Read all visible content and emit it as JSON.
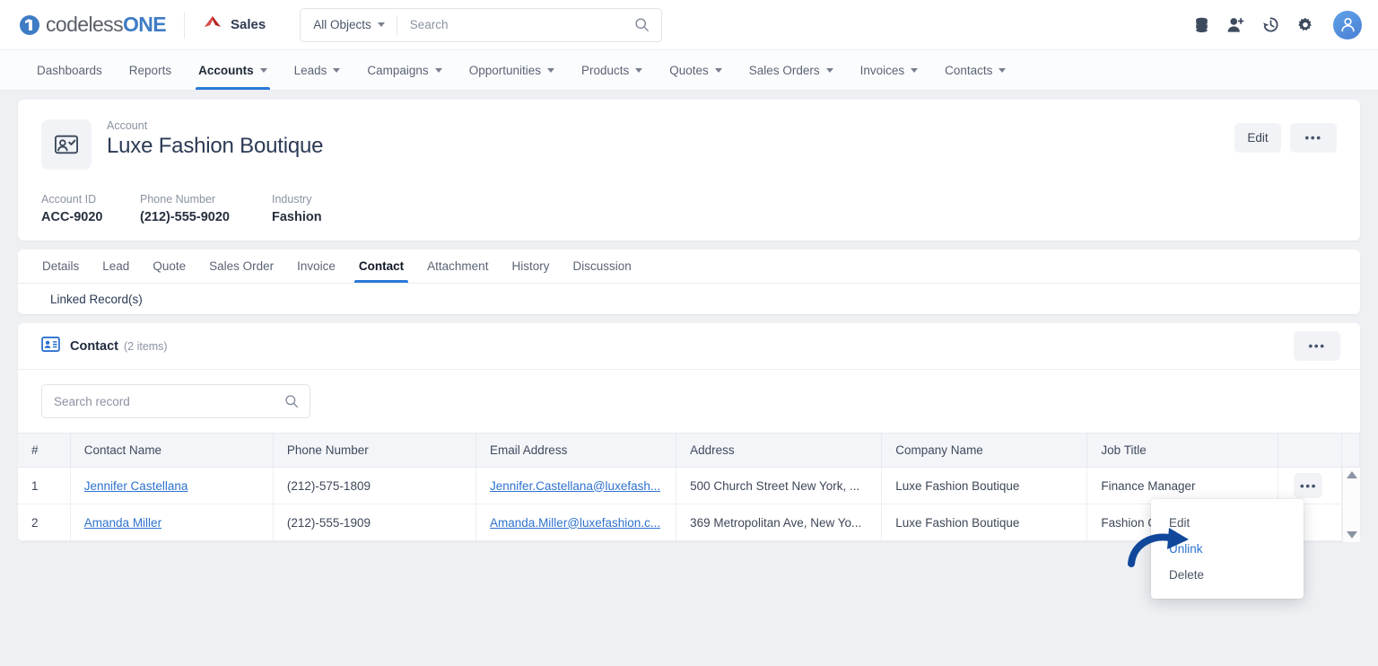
{
  "header": {
    "logo_text_1": "codeless",
    "logo_text_2": "ONE",
    "logo_mark_icon": "one-circle-icon",
    "app_icon": "sales-app-icon",
    "app_label": "Sales",
    "object_selector_label": "All Objects",
    "search_placeholder": "Search",
    "search_value": "",
    "search_icon": "search-icon",
    "icons": [
      {
        "name": "database-icon"
      },
      {
        "name": "add-user-icon"
      },
      {
        "name": "history-icon"
      },
      {
        "name": "gear-icon"
      }
    ],
    "avatar_icon": "user-avatar-icon"
  },
  "nav": {
    "items": [
      {
        "label": "Dashboards",
        "has_caret": false,
        "active": false
      },
      {
        "label": "Reports",
        "has_caret": false,
        "active": false
      },
      {
        "label": "Accounts",
        "has_caret": true,
        "active": true
      },
      {
        "label": "Leads",
        "has_caret": true,
        "active": false
      },
      {
        "label": "Campaigns",
        "has_caret": true,
        "active": false
      },
      {
        "label": "Opportunities",
        "has_caret": true,
        "active": false
      },
      {
        "label": "Products",
        "has_caret": true,
        "active": false
      },
      {
        "label": "Quotes",
        "has_caret": true,
        "active": false
      },
      {
        "label": "Sales Orders",
        "has_caret": true,
        "active": false
      },
      {
        "label": "Invoices",
        "has_caret": true,
        "active": false
      },
      {
        "label": "Contacts",
        "has_caret": true,
        "active": false
      }
    ]
  },
  "account": {
    "thumb_icon": "account-card-icon",
    "kicker": "Account",
    "title": "Luxe Fashion Boutique",
    "edit_label": "Edit",
    "more_label": "•••",
    "fields": [
      {
        "label": "Account ID",
        "value": "ACC-9020"
      },
      {
        "label": "Phone Number",
        "value": "(212)-555-9020"
      },
      {
        "label": "Industry",
        "value": "Fashion"
      }
    ]
  },
  "record_tabs": {
    "items": [
      {
        "label": "Details",
        "active": false
      },
      {
        "label": "Lead",
        "active": false
      },
      {
        "label": "Quote",
        "active": false
      },
      {
        "label": "Sales Order",
        "active": false
      },
      {
        "label": "Invoice",
        "active": false
      },
      {
        "label": "Contact",
        "active": true
      },
      {
        "label": "Attachment",
        "active": false
      },
      {
        "label": "History",
        "active": false
      },
      {
        "label": "Discussion",
        "active": false
      }
    ],
    "linked_records_label": "Linked Record(s)"
  },
  "contact_panel": {
    "section_icon": "contact-card-icon",
    "title": "Contact",
    "count": "(2 items)",
    "more_label": "•••",
    "search_placeholder": "Search record",
    "search_value": "",
    "search_icon": "search-icon",
    "columns": [
      "#",
      "Contact Name",
      "Phone Number",
      "Email Address",
      "Address",
      "Company Name",
      "Job Title",
      ""
    ],
    "rows": [
      {
        "num": "1",
        "contact_name": "Jennifer Castellana",
        "phone": "(212)-575-1809",
        "email": "Jennifer.Castellana@luxefash...",
        "address": "500 Church Street New York, ...",
        "company": "Luxe Fashion Boutique",
        "job_title": "Finance Manager",
        "row_more": "•••"
      },
      {
        "num": "2",
        "contact_name": "Amanda Miller",
        "phone": "(212)-555-1909",
        "email": "Amanda.Miller@luxefashion.c...",
        "address": "369 Metropolitan Ave, New Yo...",
        "company": "Luxe Fashion Boutique",
        "job_title": "Fashion Cons",
        "row_more": "•••"
      }
    ],
    "scroll_up_icon": "scroll-up-arrow-icon",
    "scroll_down_icon": "scroll-down-arrow-icon"
  },
  "context_menu": {
    "items": [
      {
        "label": "Edit",
        "highlighted": false
      },
      {
        "label": "Unlink",
        "highlighted": true
      },
      {
        "label": "Delete",
        "highlighted": false
      }
    ]
  },
  "annotation": {
    "arrow_icon": "pointer-arrow-icon",
    "color": "#11479b"
  },
  "colors": {
    "accent": "#2979d8",
    "link": "#2e72cf",
    "page_bg": "#eef0f3",
    "logo_blue": "#3e7cc4",
    "annotation_blue": "#11479b"
  }
}
